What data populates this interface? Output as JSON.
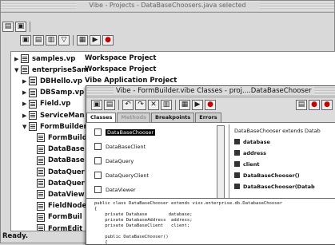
{
  "window": {
    "title": "Vibe - Projects - DataBaseChoosers.java selected"
  },
  "tree": {
    "rows": [
      {
        "name": "samples.vp",
        "desc": "Workspace Project",
        "expanded": false
      },
      {
        "name": "enterpriseSam",
        "desc": "Workspace Project",
        "expanded": true
      },
      {
        "name": "DBHello.vp",
        "desc": "Vibe Application Project",
        "expanded": false
      },
      {
        "name": "DBSamp.vp",
        "desc": "",
        "expanded": false
      },
      {
        "name": "Field.vp",
        "desc": "",
        "expanded": false
      },
      {
        "name": "ServiceMan",
        "desc": "",
        "expanded": false
      },
      {
        "name": "FormBuilder",
        "desc": "",
        "expanded": true
      },
      {
        "name": "FormBuild",
        "desc": ""
      },
      {
        "name": "DataBase",
        "desc": ""
      },
      {
        "name": "DataBase",
        "desc": ""
      },
      {
        "name": "DataQuer",
        "desc": ""
      },
      {
        "name": "DataQuer",
        "desc": ""
      },
      {
        "name": "DataView",
        "desc": ""
      },
      {
        "name": "FieldNode",
        "desc": ""
      },
      {
        "name": "FormBuil",
        "desc": ""
      },
      {
        "name": "FormEdit",
        "desc": ""
      }
    ]
  },
  "status": "Ready.",
  "inner": {
    "title": "Vibe - FormBuilder.vibe Classes - proj....DataBaseChooser",
    "tabs": [
      "Classes",
      "Methods",
      "Breakpoints",
      "Errors"
    ],
    "classes": [
      "DataBaseChooser",
      "DataBaseClient",
      "DataQuery",
      "DataQueryClient",
      "DataViewer"
    ],
    "members_header": "DataBaseChooser extends Datab",
    "members": [
      "database",
      "address",
      "client",
      "DataBaseChooser()",
      "DataBaseChooser(Datab"
    ],
    "code": [
      "public class DataBaseChooser extends vixx.enterprise.db.DatabaseChooser",
      "{",
      "    private Database        database;",
      "    private DatabaseAddress  address;",
      "    private DataBaseClient   client;",
      "",
      "    public DataBaseChooser()",
      "    {"
    ]
  }
}
